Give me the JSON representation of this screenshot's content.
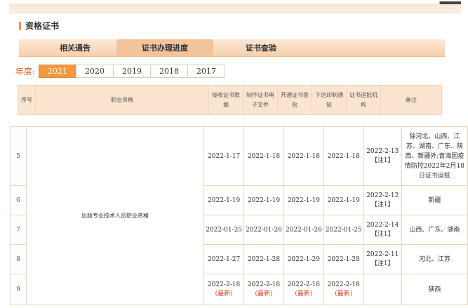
{
  "section": {
    "title": "资格证书"
  },
  "tabs": [
    {
      "label": "相关通告"
    },
    {
      "label": "证书办理进度"
    },
    {
      "label": "证书查验"
    }
  ],
  "year_filter": {
    "label": "年度:",
    "years": [
      "2021",
      "2020",
      "2019",
      "2018",
      "2017"
    ],
    "selected": "2021"
  },
  "table_header": {
    "seq": "序号",
    "qualification": "职业资格",
    "received": "接收证书数据",
    "made": "制作证书电子文件",
    "opened": "开通证书查验",
    "issued": "下达印制通知",
    "shipped": "证书运抵机构",
    "remark": "备注"
  },
  "qualification_name": "出版专业技术人员职业资格",
  "rows": [
    {
      "seq": "5",
      "received": "2022-1-17",
      "made": "2022-1-18",
      "opened": "2022-1-18",
      "issued": "2022-1-18",
      "shipped": "2022-2-13",
      "shipped_note": "【注1】",
      "remark": "除河北、山西、江苏、湖南、广东、陕西、新疆外;青海因疫情防控2022年2月18日证书运抵"
    },
    {
      "seq": "6",
      "received": "2022-1-19",
      "made": "2022-1-19",
      "opened": "2022-1-19",
      "issued": "2022-1-19",
      "shipped": "2022-2-12",
      "shipped_note": "【注1】",
      "remark": "新疆"
    },
    {
      "seq": "7",
      "received": "2022-01-25",
      "made": "2022-01-26",
      "opened": "2022-01-26",
      "issued": "2022-01-25",
      "shipped": "2022-2-14",
      "shipped_note": "【注1】",
      "remark": "山西、广东、湖南"
    },
    {
      "seq": "8",
      "received": "2022-1-27",
      "made": "2022-1-28",
      "opened": "2022-1-29",
      "issued": "2022-1-28",
      "shipped": "2022-2-11",
      "shipped_note": "【注1】",
      "remark": "河北、江苏"
    },
    {
      "seq": "9",
      "received": "2022-2-18",
      "made": "2022-2-18",
      "opened": "2022-2-18",
      "issued": "2022-2-18",
      "latest_label": "(最新)",
      "shipped": "",
      "shipped_note": "",
      "remark": "陕西"
    }
  ]
}
